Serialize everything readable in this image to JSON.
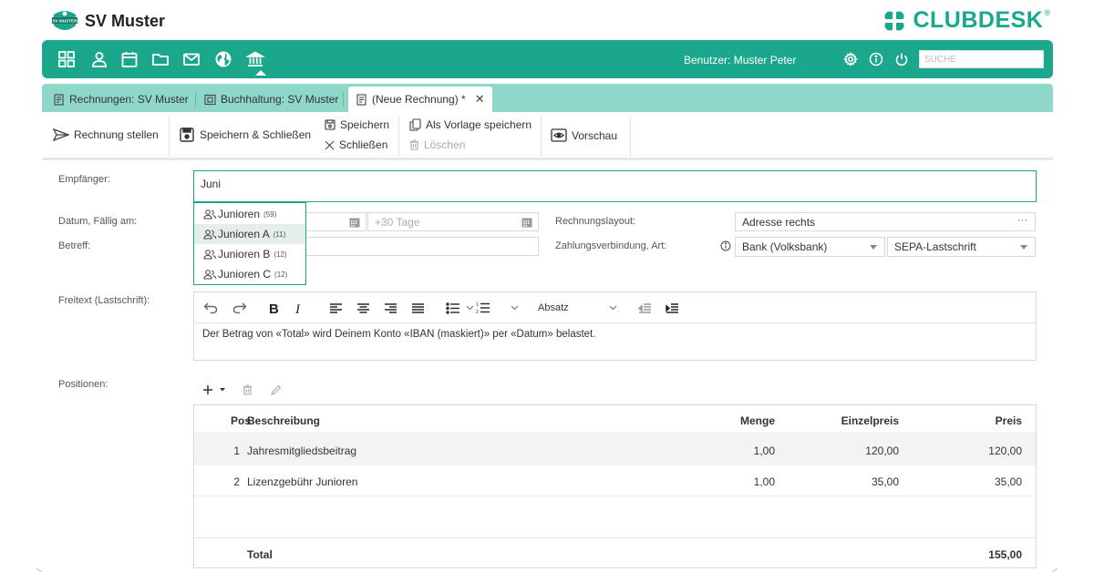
{
  "header": {
    "club_name": "SV Muster",
    "logo_text": "SV MUSTER",
    "brand": "CLUBDESK",
    "brand_mark": "®"
  },
  "nav": {
    "icons": [
      "dashboard-icon",
      "member-icon",
      "calendar-icon",
      "folder-icon",
      "mail-icon",
      "globe-icon",
      "bank-icon"
    ],
    "user_label": "Benutzer: Muster Peter",
    "search_placeholder": "SUCHE"
  },
  "tabs": [
    {
      "label": "Rechnungen: SV Muster"
    },
    {
      "label": "Buchhaltung: SV Muster"
    },
    {
      "label": "(Neue Rechnung) *"
    }
  ],
  "toolbar": {
    "send": "Rechnung stellen",
    "save_close": "Speichern & Schließen",
    "save": "Speichern",
    "close": "Schließen",
    "save_template": "Als Vorlage speichern",
    "delete": "Löschen",
    "preview": "Vorschau"
  },
  "form": {
    "recipient_label": "Empfänger:",
    "recipient_value": "Juni",
    "date_label": "Datum, Fällig am:",
    "due_placeholder": "+30 Tage",
    "subject_label": "Betreff:",
    "layout_label": "Rechnungslayout:",
    "layout_value": "Adresse rechts",
    "payment_label": "Zahlungsverbindung, Art:",
    "payment_account": "Bank (Volksbank)",
    "payment_type": "SEPA-Lastschrift",
    "freetext_label": "Freitext (Lastschrift):",
    "freetext_body": "Der Betrag von «Total» wird Deinem Konto «IBAN (maskiert)» per «Datum» belastet.",
    "paragraph_style": "Absatz",
    "positions_label": "Positionen:"
  },
  "dropdown": [
    {
      "name": "Junioren",
      "count": "(59)"
    },
    {
      "name": "Junioren A",
      "count": "(11)"
    },
    {
      "name": "Junioren B",
      "count": "(12)"
    },
    {
      "name": "Junioren C",
      "count": "(12)"
    }
  ],
  "table": {
    "headers": {
      "pos": "Pos",
      "desc": "Beschreibung",
      "qty": "Menge",
      "unit": "Einzelpreis",
      "price": "Preis"
    },
    "rows": [
      {
        "pos": "1",
        "desc": "Jahresmitgliedsbeitrag",
        "qty": "1,00",
        "unit": "120,00",
        "price": "120,00"
      },
      {
        "pos": "2",
        "desc": "Lizenzgebühr Junioren",
        "qty": "1,00",
        "unit": "35,00",
        "price": "35,00"
      }
    ],
    "total_label": "Total",
    "total_value": "155,00"
  },
  "colors": {
    "accent": "#1ba78b",
    "tabbar": "#8fd7c8"
  }
}
